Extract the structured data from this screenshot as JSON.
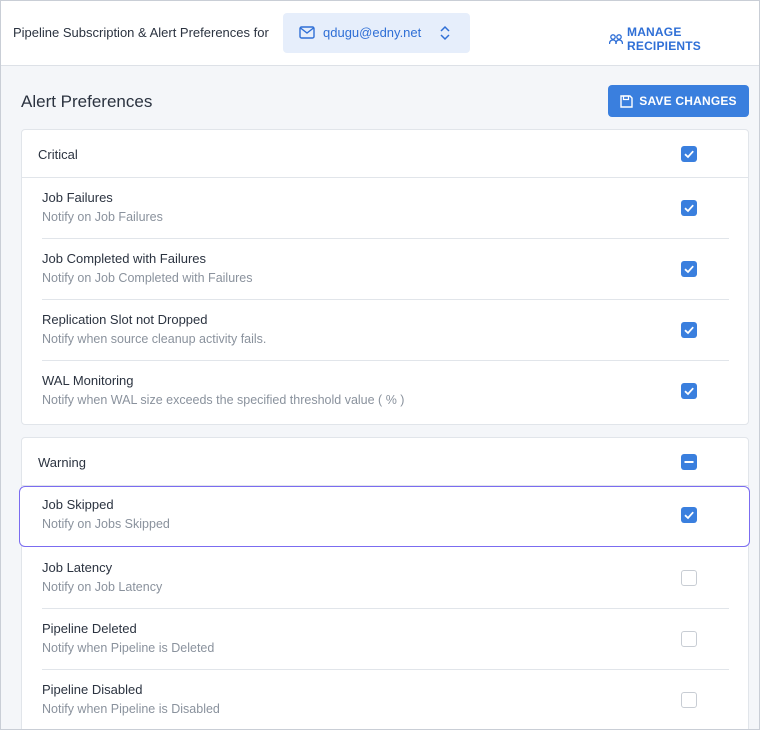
{
  "header": {
    "title": "Pipeline Subscription & Alert Preferences for",
    "email": "qdugu@edny.net",
    "manage_label": "MANAGE RECIPIENTS"
  },
  "main": {
    "title": "Alert Preferences",
    "save_label": "SAVE CHANGES"
  },
  "groups": [
    {
      "label": "Critical",
      "state": "checked",
      "items": [
        {
          "name": "Job Failures",
          "desc": "Notify on Job Failures",
          "checked": true
        },
        {
          "name": "Job Completed with Failures",
          "desc": "Notify on Job Completed with Failures",
          "checked": true
        },
        {
          "name": "Replication Slot not Dropped",
          "desc": "Notify when source cleanup activity fails.",
          "checked": true
        },
        {
          "name": "WAL Monitoring",
          "desc": "Notify when WAL size exceeds the specified threshold value ( % )",
          "checked": true
        }
      ]
    },
    {
      "label": "Warning",
      "state": "indeterminate",
      "items": [
        {
          "name": "Job Skipped",
          "desc": "Notify on Jobs Skipped",
          "checked": true
        },
        {
          "name": "Job Latency",
          "desc": "Notify on Job Latency",
          "checked": false
        },
        {
          "name": "Pipeline Deleted",
          "desc": "Notify when Pipeline is Deleted",
          "checked": false
        },
        {
          "name": "Pipeline Disabled",
          "desc": "Notify when Pipeline is Disabled",
          "checked": false
        }
      ]
    }
  ],
  "colors": {
    "accent": "#3a7fde",
    "focus": "#7b6cf0"
  }
}
